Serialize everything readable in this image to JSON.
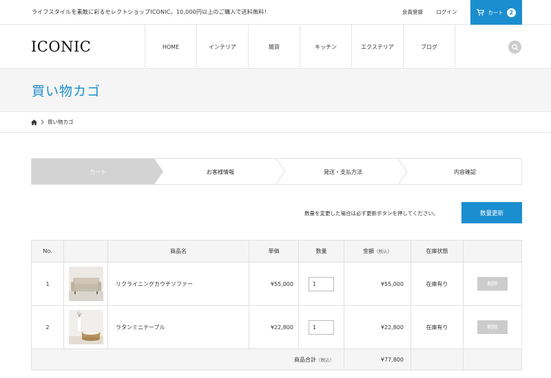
{
  "topbar": {
    "notice": "ライフスタイルを素敵に彩るセレクトショップICONIC。10,000円以上のご購入で送料無料！",
    "register": "会員登録",
    "login": "ログイン",
    "cart_label": "カート",
    "cart_count": "2"
  },
  "header": {
    "logo": "ICONIC",
    "nav": [
      "HOME",
      "インテリア",
      "雑貨",
      "キッチン",
      "エクステリア",
      "ブログ"
    ]
  },
  "page": {
    "title": "買い物カゴ",
    "breadcrumb_current": "買い物カゴ"
  },
  "steps": [
    "カート",
    "お客様情報",
    "発送・支払方法",
    "内容確認"
  ],
  "update": {
    "note": "数量を変更した場合は必ず更新ボタンを押してください。",
    "button": "数量更新"
  },
  "table": {
    "headers": {
      "no": "No.",
      "name": "商品名",
      "unit_price": "単価",
      "qty": "数量",
      "amount": "金額",
      "amount_note": "（税込）",
      "stock": "在庫状態"
    },
    "rows": [
      {
        "no": "1",
        "name": "リクライニングカウチソファー",
        "price": "¥55,000",
        "qty": "1",
        "amount": "¥55,000",
        "stock": "在庫有り",
        "delete": "削除"
      },
      {
        "no": "2",
        "name": "ラタンミニテーブル",
        "price": "¥22,800",
        "qty": "1",
        "amount": "¥22,800",
        "stock": "在庫有り",
        "delete": "削除"
      }
    ],
    "total_label": "商品合計",
    "total_note": "（税込）",
    "total_value": "¥77,800"
  },
  "colors": {
    "accent": "#1b8ecf",
    "muted_button": "#cccccc",
    "band": "#f5f5f5"
  }
}
